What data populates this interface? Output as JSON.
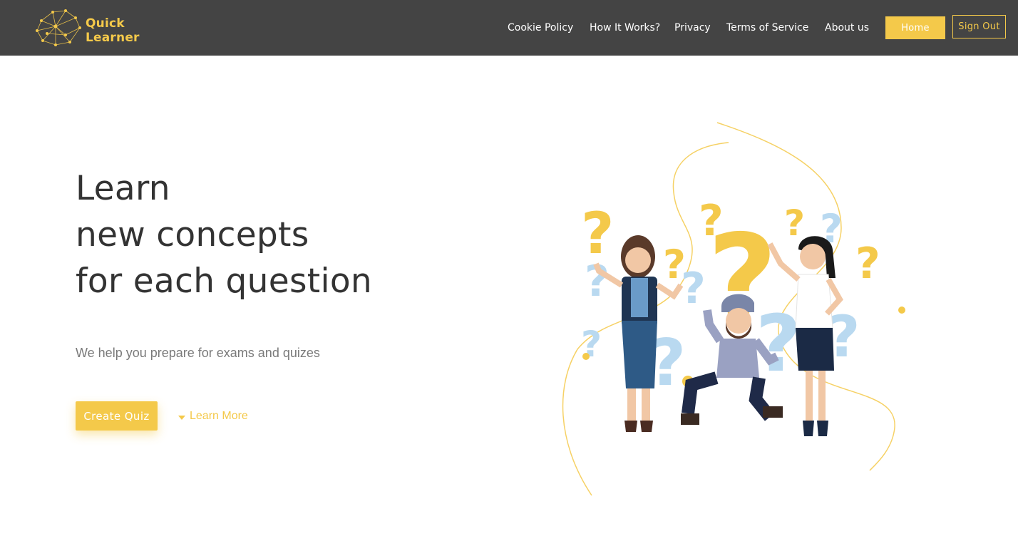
{
  "brand": {
    "line1": "Quick",
    "line2": "Learner"
  },
  "nav": {
    "links": [
      {
        "label": "Cookie Policy"
      },
      {
        "label": "How It Works?"
      },
      {
        "label": "Privacy"
      },
      {
        "label": "Terms of Service"
      },
      {
        "label": "About us"
      }
    ],
    "home_label": "Home",
    "signout_label": "Sign Out"
  },
  "hero": {
    "title_lines": [
      "Learn",
      "new concepts",
      "for each question"
    ],
    "subtitle": "We help you prepare for exams and quizes",
    "create_label": "Create Quiz",
    "learn_more_label": "Learn More"
  },
  "colors": {
    "accent": "#f4c94a",
    "header_bg": "#444444",
    "title": "#333333",
    "subtitle": "#7a7a7a"
  },
  "icons": {
    "logo": "network-brain-icon",
    "learn_more": "caret-down-icon"
  }
}
